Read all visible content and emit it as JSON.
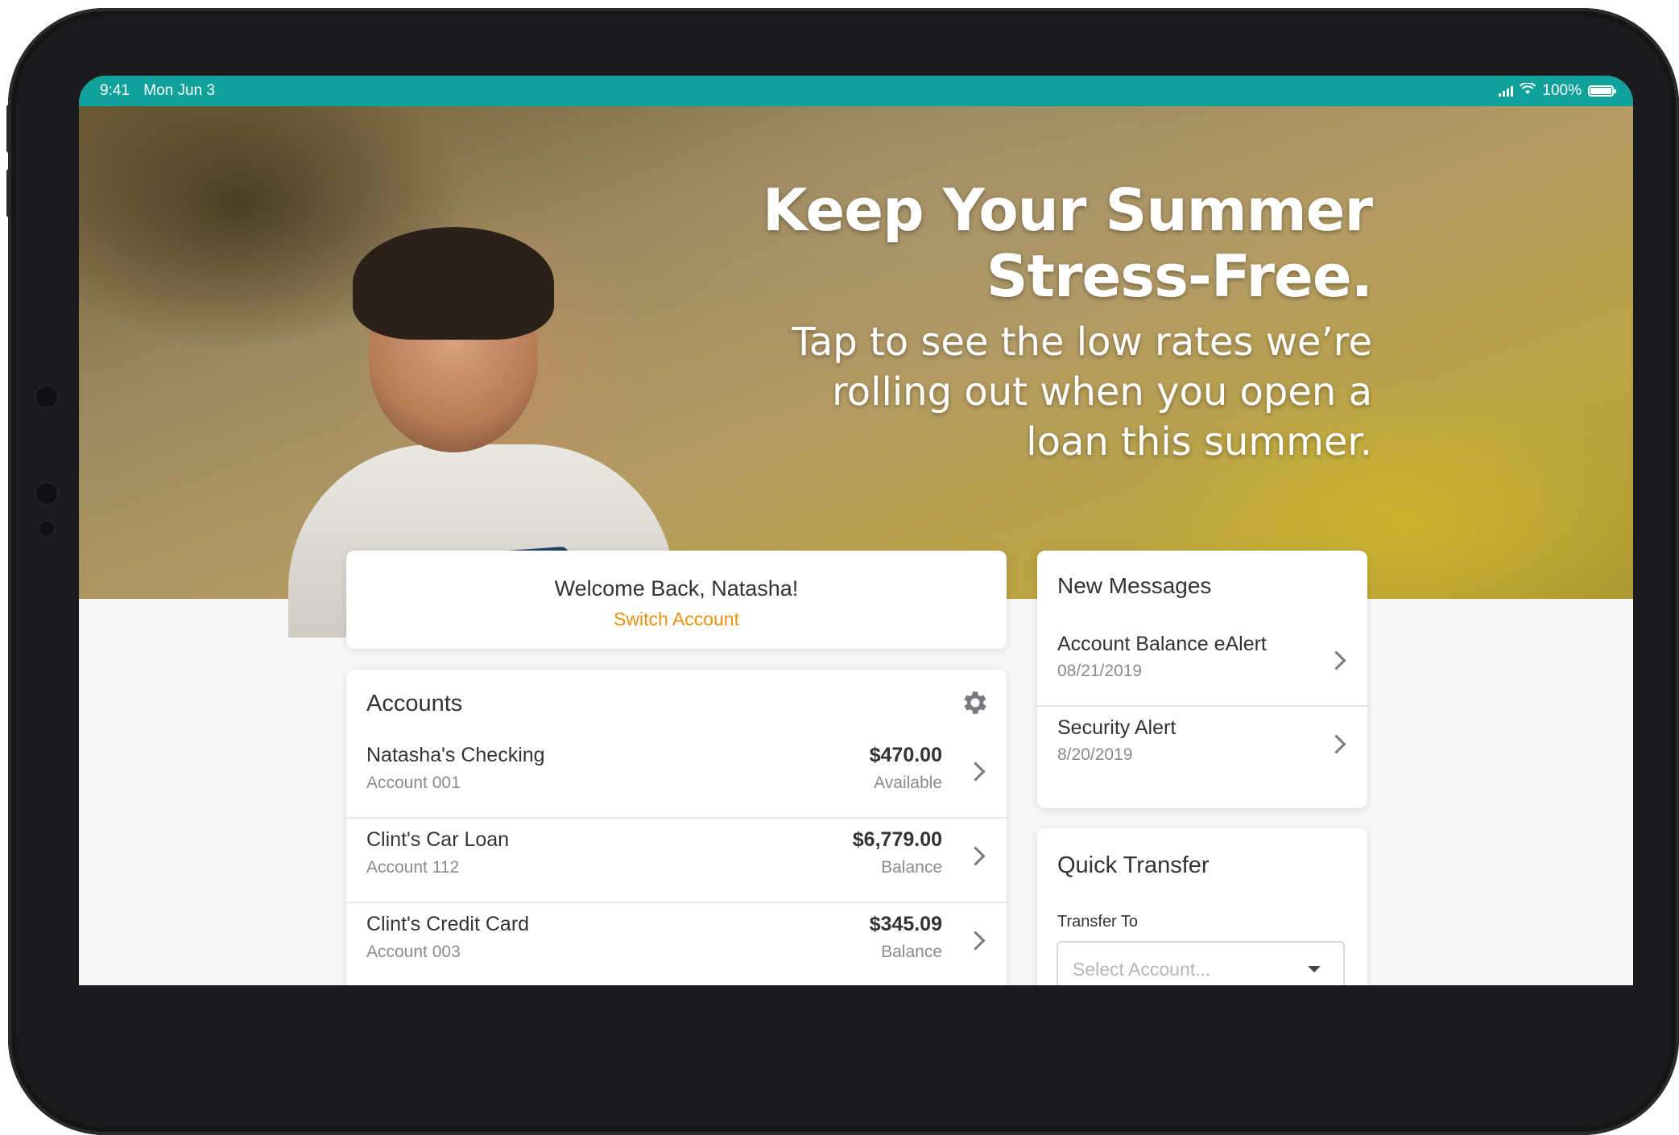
{
  "status_bar": {
    "time": "9:41",
    "date": "Mon Jun 3",
    "battery": "100%"
  },
  "hero": {
    "title_line1": "Keep Your Summer",
    "title_line2": "Stress-Free.",
    "subtitle_line1": "Tap to see the low rates we’re",
    "subtitle_line2": "rolling out when you open a",
    "subtitle_line3": "loan this summer."
  },
  "welcome": {
    "greeting": "Welcome Back, Natasha!",
    "switch_account": "Switch Account"
  },
  "accounts": {
    "title": "Accounts",
    "items": [
      {
        "name": "Natasha's Checking",
        "number": "Account 001",
        "amount": "$470.00",
        "type": "Available"
      },
      {
        "name": "Clint's Car Loan",
        "number": "Account 112",
        "amount": "$6,779.00",
        "type": "Balance"
      },
      {
        "name": "Clint's Credit Card",
        "number": "Account 003",
        "amount": "$345.09",
        "type": "Balance"
      }
    ]
  },
  "messages": {
    "title": "New Messages",
    "items": [
      {
        "title": "Account Balance eAlert",
        "date": "08/21/2019"
      },
      {
        "title": "Security Alert",
        "date": "8/20/2019"
      }
    ]
  },
  "quick_transfer": {
    "title": "Quick Transfer",
    "label": "Transfer To",
    "placeholder": "Select Account..."
  },
  "colors": {
    "status_bar": "#10a19a",
    "accent": "#e5920e"
  }
}
